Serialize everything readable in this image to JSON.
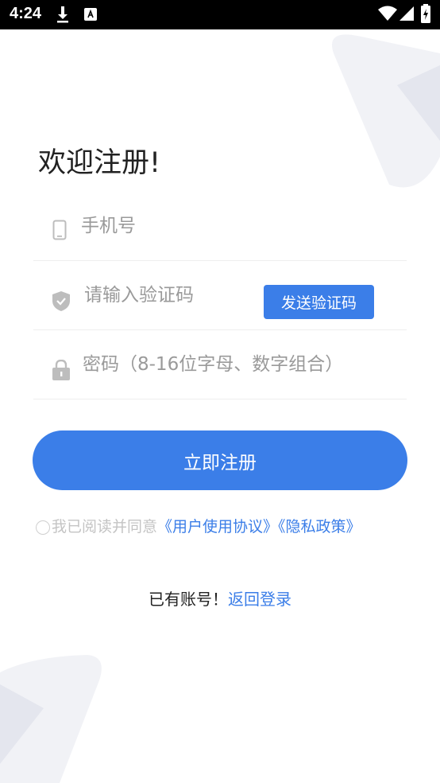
{
  "status_bar": {
    "time": "4:24",
    "icons": [
      "download-icon",
      "accessibility-icon",
      "wifi-icon",
      "signal-icon",
      "battery-icon"
    ]
  },
  "title": "欢迎注册!",
  "phone": {
    "placeholder": "手机号",
    "icon": "phone-icon"
  },
  "code": {
    "placeholder": "请输入验证码",
    "icon": "shield-icon",
    "send_label": "发送验证码"
  },
  "password": {
    "placeholder": "密码（8-16位字母、数字组合）",
    "icon": "lock-icon"
  },
  "register_label": "立即注册",
  "agreement": {
    "text": "我已阅读并同意",
    "user_agreement": "《用户使用协议》",
    "privacy_policy": "《隐私政策》"
  },
  "login": {
    "prefix": "已有账号！",
    "link": "返回登录"
  },
  "colors": {
    "accent": "#3b7ee8",
    "text": "#222222",
    "hint": "#9a9a9a"
  }
}
